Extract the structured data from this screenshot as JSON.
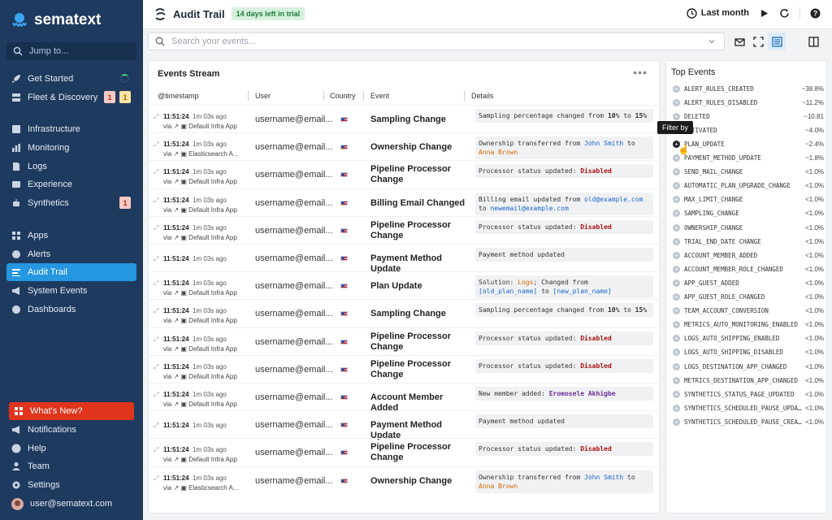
{
  "brand": {
    "name": "sematext"
  },
  "sidebar": {
    "jump_placeholder": "Jump to...",
    "items": [
      {
        "label": "Get Started"
      },
      {
        "label": "Fleet & Discovery",
        "badges": [
          "1",
          "1"
        ]
      },
      {
        "label": "Infrastructure"
      },
      {
        "label": "Monitoring"
      },
      {
        "label": "Logs"
      },
      {
        "label": "Experience"
      },
      {
        "label": "Synthetics",
        "badges": [
          "1"
        ]
      },
      {
        "label": "Apps"
      },
      {
        "label": "Alerts"
      },
      {
        "label": "Audit Trail"
      },
      {
        "label": "System Events"
      },
      {
        "label": "Dashboards"
      }
    ],
    "bottom": [
      {
        "label": "What's New?"
      },
      {
        "label": "Notifications"
      },
      {
        "label": "Help"
      },
      {
        "label": "Team"
      },
      {
        "label": "Settings"
      },
      {
        "label": "user@sematext.com"
      }
    ]
  },
  "header": {
    "title": "Audit Trail",
    "trial": "14 days left in trial",
    "range": "Last month"
  },
  "search": {
    "placeholder": "Search your events..."
  },
  "events": {
    "title": "Events Stream",
    "columns": [
      "@timestamp",
      "User",
      "Country",
      "Event",
      "Details"
    ],
    "rows": [
      {
        "time": "11:51:24",
        "ago": "1m 03s ago",
        "via": "Default Infra App",
        "user": "username@email...",
        "event": "Sampling Change",
        "details": [
          {
            "t": "Sampling percentage changed from "
          },
          {
            "t": "10%",
            "c": "b"
          },
          {
            "t": " to "
          },
          {
            "t": "15%",
            "c": "b"
          }
        ]
      },
      {
        "time": "11:51:24",
        "ago": "1m 03s ago",
        "via": "Elasticsearch A...",
        "user": "username@email...",
        "event": "Ownership Change",
        "details": [
          {
            "t": "Ownership transferred from "
          },
          {
            "t": "John Smith",
            "c": "blue"
          },
          {
            "t": " to "
          },
          {
            "t": "Anna Brown",
            "c": "orange"
          }
        ]
      },
      {
        "time": "11:51:24",
        "ago": "1m 03s ago",
        "via": "Default Infra App",
        "user": "username@email...",
        "event": "Pipeline Processor Change",
        "details": [
          {
            "t": "Processor status updated: "
          },
          {
            "t": "Disabled",
            "c": "red"
          }
        ]
      },
      {
        "time": "11:51:24",
        "ago": "1m 03s ago",
        "via": "Default Infra App",
        "user": "username@email...",
        "event": "Billing Email Changed",
        "details": [
          {
            "t": "Billing email updated from "
          },
          {
            "t": "old@example.com",
            "c": "blue"
          },
          {
            "t": " to "
          },
          {
            "t": "newemail@example.com",
            "c": "blue"
          }
        ]
      },
      {
        "time": "11:51:24",
        "ago": "1m 03s ago",
        "via": "Default Infra App",
        "user": "username@email...",
        "event": "Pipeline Processor Change",
        "details": [
          {
            "t": "Processor status updated: "
          },
          {
            "t": "Disabled",
            "c": "red"
          }
        ]
      },
      {
        "time": "11:51:24",
        "ago": "1m 03s ago",
        "via": "",
        "user": "username@email...",
        "event": "Payment Method Update",
        "details": [
          {
            "t": "Payment method updated"
          }
        ]
      },
      {
        "time": "11:51:24",
        "ago": "1m 03s ago",
        "via": "Default Infra App",
        "user": "username@email...",
        "event": "Plan Update",
        "details": [
          {
            "t": "Solution: "
          },
          {
            "t": "Logs",
            "c": "orange"
          },
          {
            "t": "; Changed from "
          },
          {
            "t": "[old_plan_name]",
            "c": "blue"
          },
          {
            "t": " to "
          },
          {
            "t": "[new_plan_name]",
            "c": "blue"
          }
        ]
      },
      {
        "time": "11:51:24",
        "ago": "1m 03s ago",
        "via": "Default Infra App",
        "user": "username@email...",
        "event": "Sampling Change",
        "details": [
          {
            "t": "Sampling percentage changed from "
          },
          {
            "t": "10%",
            "c": "b"
          },
          {
            "t": " to "
          },
          {
            "t": "15%",
            "c": "b"
          }
        ]
      },
      {
        "time": "11:51:24",
        "ago": "1m 03s ago",
        "via": "Default Infra App",
        "user": "username@email...",
        "event": "Pipeline Processor Change",
        "details": [
          {
            "t": "Processor status updated: "
          },
          {
            "t": "Disabled",
            "c": "red"
          }
        ]
      },
      {
        "time": "11:51:24",
        "ago": "1m 03s ago",
        "via": "Default Infra App",
        "user": "username@email...",
        "event": "Pipeline Processor Change",
        "details": [
          {
            "t": "Processor status updated: "
          },
          {
            "t": "Disabled",
            "c": "red"
          }
        ]
      },
      {
        "time": "11:51:24",
        "ago": "1m 03s ago",
        "via": "Default Infra App",
        "user": "username@email...",
        "event": "Account Member Added",
        "details": [
          {
            "t": "New member added: "
          },
          {
            "t": "Eromosele Akhigbe",
            "c": "purple"
          }
        ]
      },
      {
        "time": "11:51:24",
        "ago": "1m 03s ago",
        "via": "",
        "user": "username@email...",
        "event": "Payment Method Update",
        "details": [
          {
            "t": "Payment method updated"
          }
        ]
      },
      {
        "time": "11:51:24",
        "ago": "1m 03s ago",
        "via": "Default Infra App",
        "user": "username@email...",
        "event": "Pipeline Processor Change",
        "details": [
          {
            "t": "Processor status updated: "
          },
          {
            "t": "Disabled",
            "c": "red"
          }
        ]
      },
      {
        "time": "11:51:24",
        "ago": "1m 03s ago",
        "via": "Elasticsearch A...",
        "user": "username@email...",
        "event": "Ownership Change",
        "details": [
          {
            "t": "Ownership transferred from "
          },
          {
            "t": "John Smith",
            "c": "blue"
          },
          {
            "t": " to "
          },
          {
            "t": "Anna Brown",
            "c": "orange"
          }
        ]
      }
    ]
  },
  "top_events": {
    "title": "Top Events",
    "tooltip": "Filter by",
    "items": [
      {
        "name": "ALERT_RULES_CREATED",
        "pct": "~38.8%"
      },
      {
        "name": "ALERT_RULES_DISABLED",
        "pct": "~11.2%"
      },
      {
        "name": "DELETED",
        "pct": "~10.81"
      },
      {
        "name": "ACTIVATED",
        "pct": "~4.0%"
      },
      {
        "name": "PLAN_UPDATE",
        "pct": "~2.4%"
      },
      {
        "name": "PAYMENT_METHOD_UPDATE",
        "pct": "~1.8%"
      },
      {
        "name": "SEND_MAIL_CHANGE",
        "pct": "<1.0%"
      },
      {
        "name": "AUTOMATIC_PLAN_UPGRADE_CHANGE",
        "pct": "<1.0%"
      },
      {
        "name": "MAX_LIMIT_CHANGE",
        "pct": "<1.0%"
      },
      {
        "name": "SAMPLING_CHANGE",
        "pct": "<1.0%"
      },
      {
        "name": "OWNERSHIP_CHANGE",
        "pct": "<1.0%"
      },
      {
        "name": "TRIAL_END_DATE CHANGE",
        "pct": "<1.0%"
      },
      {
        "name": "ACCOUNT_MEMBER_ADDED",
        "pct": "<1.0%"
      },
      {
        "name": "ACCOUNT_MEMBER_ROLE_CHANGED",
        "pct": "<1.0%"
      },
      {
        "name": "APP_GUEST_ADDED",
        "pct": "<1.0%"
      },
      {
        "name": "APP_GUEST_ROLE_CHANGED",
        "pct": "<1.0%"
      },
      {
        "name": "TEAM_ACCOUNT_CONVERSION",
        "pct": "<1.0%"
      },
      {
        "name": "METRICS_AUTO_MONITORING_ENABLED",
        "pct": "<1.0%"
      },
      {
        "name": "LOGS_AUTO_SHIPPING_ENABLED",
        "pct": "<1.0%"
      },
      {
        "name": "LOGS_AUTO_SHIPPING_DISABLED",
        "pct": "<1.0%"
      },
      {
        "name": "LOGS_DESTINATION_APP_CHANGED",
        "pct": "<1.0%"
      },
      {
        "name": "METRICS_DESTINATION_APP_CHANGED",
        "pct": "<1.0%"
      },
      {
        "name": "SYNTHETICS_STATUS_PAGE_UPDATED",
        "pct": "<1.0%"
      },
      {
        "name": "SYNTHETICS_SCHEDULED_PAUSE_UPDATED",
        "pct": "<1.0%"
      },
      {
        "name": "SYNTHETICS_SCHEDULED_PAUSE_CREATED",
        "pct": "<1.0%"
      }
    ]
  }
}
